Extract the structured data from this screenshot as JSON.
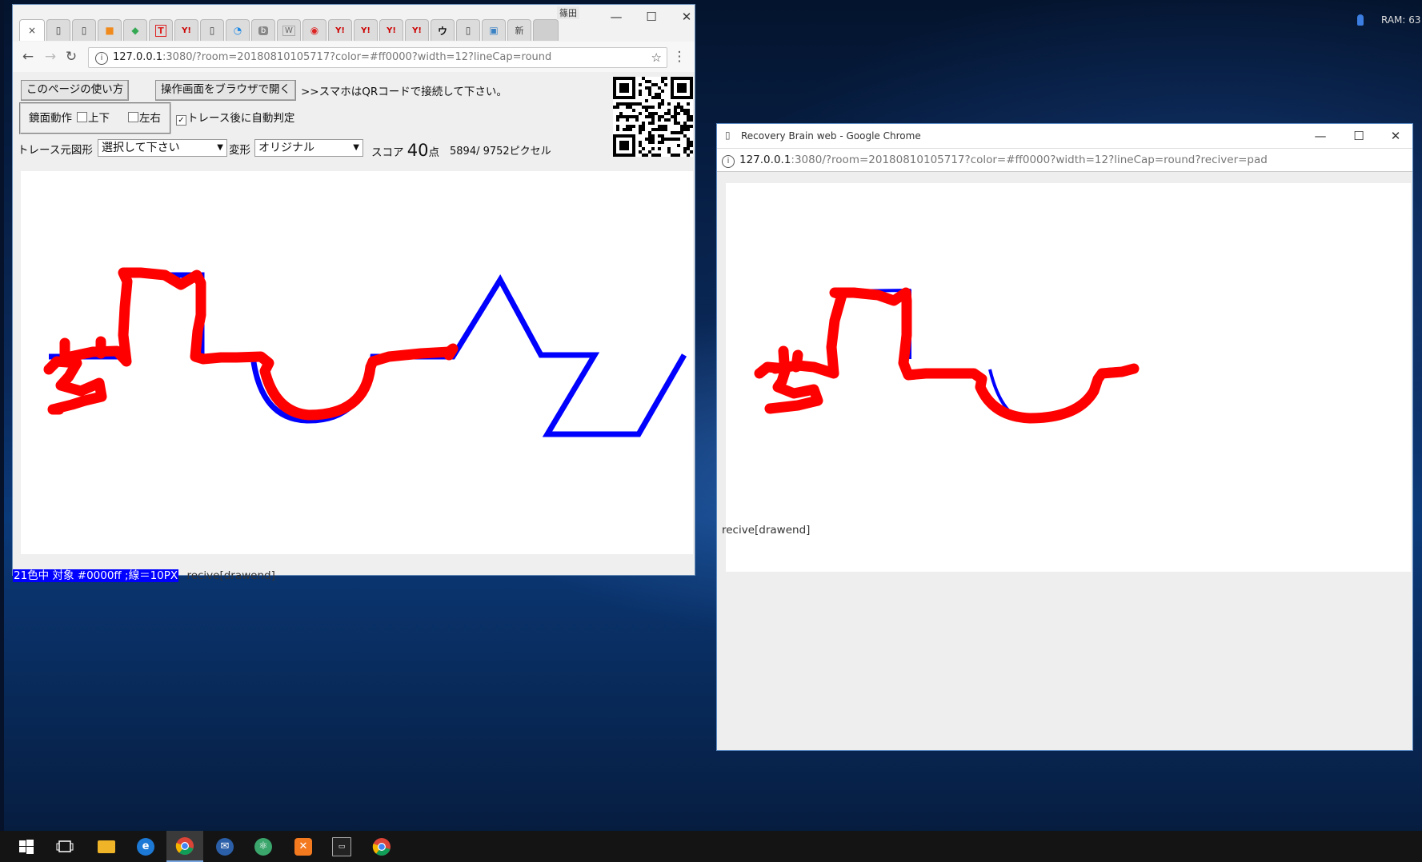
{
  "browser_main": {
    "tabs": [
      "×",
      "",
      "",
      "",
      "",
      "T",
      "Y!",
      "",
      "",
      "b",
      "W",
      "",
      "Y!",
      "Y!",
      "Y!",
      "Y!",
      "ウ",
      "",
      "",
      "新"
    ],
    "profile_label": "篠田",
    "url_host": "127.0.0.1",
    "url_rest": ":3080/?room=20180810105717?color=#ff0000?width=12?lineCap=round",
    "buttons": {
      "howto": "このページの使い方",
      "open_in_browser": "操作画面をブラウザで開く"
    },
    "qr_hint": ">>スマホはQRコードで接続して下さい。",
    "mirror": {
      "label": "鏡面動作",
      "updown": "上下",
      "leftright": "左右",
      "auto_judge": "トレース後に自動判定",
      "updown_checked": false,
      "leftright_checked": false,
      "auto_judge_checked": true
    },
    "trace_source_label": "トレース元図形",
    "trace_source_value": "選択して下さい",
    "transform_label": "変形",
    "transform_value": "オリジナル",
    "score_label": "スコア",
    "score_value": "40",
    "score_unit": "点",
    "pixels": "5894/ 9752ピクセル",
    "status_highlight": "21色中 対象 #0000ff ;線＝10PX",
    "status_text": "recive[drawend]",
    "colors": {
      "target": "#0000ff",
      "trace": "#ff0000"
    }
  },
  "browser_pad": {
    "title": "Recovery Brain web - Google Chrome",
    "url_host": "127.0.0.1",
    "url_rest": ":3080/?room=20180810105717?color=#ff0000?width=12?lineCap=round?reciver=pad",
    "status_text": "recive[drawend]"
  },
  "tray": {
    "ram_label": "RAM: 63"
  },
  "taskbar": {
    "items": [
      "start-icon",
      "task-view-icon",
      "file-explorer-icon",
      "edge-icon",
      "chrome-icon",
      "mail-icon",
      "atom-icon",
      "xampp-icon",
      "terminal-icon",
      "chrome-icon"
    ]
  }
}
